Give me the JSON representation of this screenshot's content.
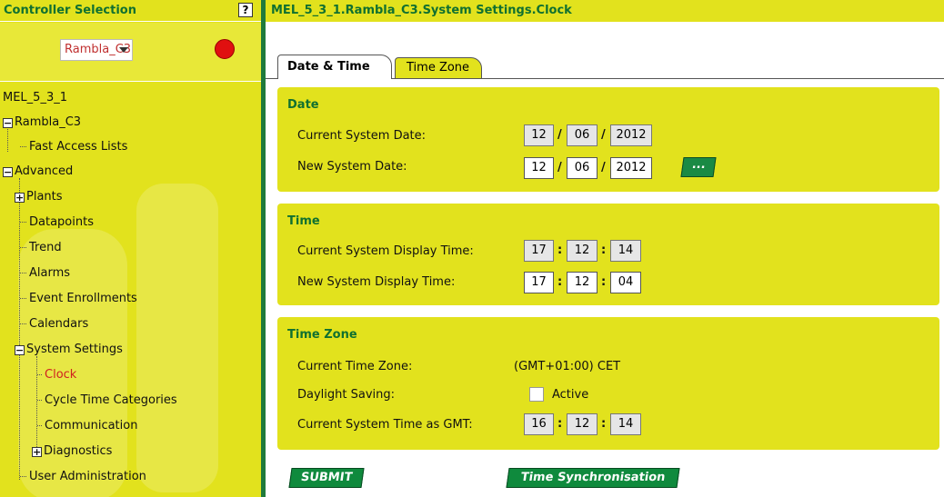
{
  "left_header": {
    "title": "Controller Selection",
    "help": "?"
  },
  "controller": {
    "selected": "Rambla_C3",
    "status_color": "#e01010"
  },
  "tree": {
    "root": "MEL_5_3_1",
    "items": [
      {
        "label": "Rambla_C3",
        "expander": "−"
      },
      {
        "label": "Fast Access Lists"
      },
      {
        "label": "Advanced",
        "expander": "−"
      },
      {
        "label": "Plants",
        "expander": "+"
      },
      {
        "label": "Datapoints"
      },
      {
        "label": "Trend"
      },
      {
        "label": "Alarms"
      },
      {
        "label": "Event Enrollments"
      },
      {
        "label": "Calendars"
      },
      {
        "label": "System Settings",
        "expander": "−"
      },
      {
        "label": "Clock"
      },
      {
        "label": "Cycle Time Categories"
      },
      {
        "label": "Communication"
      },
      {
        "label": "Diagnostics",
        "expander": "+"
      },
      {
        "label": "User Administration"
      }
    ]
  },
  "header": {
    "title": "MEL_5_3_1.Rambla_C3.System Settings.Clock"
  },
  "tabs": [
    {
      "label": "Date & Time"
    },
    {
      "label": "Time Zone"
    }
  ],
  "date": {
    "title": "Date",
    "current_label": "Current System Date:",
    "current": {
      "day": "12",
      "month": "06",
      "year": "2012"
    },
    "new_label": "New System Date:",
    "new": {
      "day": "12",
      "month": "06",
      "year": "2012"
    },
    "picker_label": "...",
    "sep": "/"
  },
  "time": {
    "title": "Time",
    "current_label": "Current System Display Time:",
    "current": {
      "h": "17",
      "m": "12",
      "s": "14"
    },
    "new_label": "New System Display Time:",
    "new": {
      "h": "17",
      "m": "12",
      "s": "04"
    },
    "sep": ":"
  },
  "timezone": {
    "title": "Time Zone",
    "current_label": "Current Time Zone:",
    "current_value": "(GMT+01:00) CET",
    "dst_label": "Daylight Saving:",
    "dst_checkbox_label": "Active",
    "gmt_label": "Current System Time as GMT:",
    "gmt": {
      "h": "16",
      "m": "12",
      "s": "14"
    }
  },
  "buttons": {
    "submit": "SUBMIT",
    "sync": "Time Synchronisation"
  },
  "colors": {
    "accent_yellow": "#e2e21d",
    "brand_green": "#107030",
    "button_green": "#0f8a3d"
  }
}
